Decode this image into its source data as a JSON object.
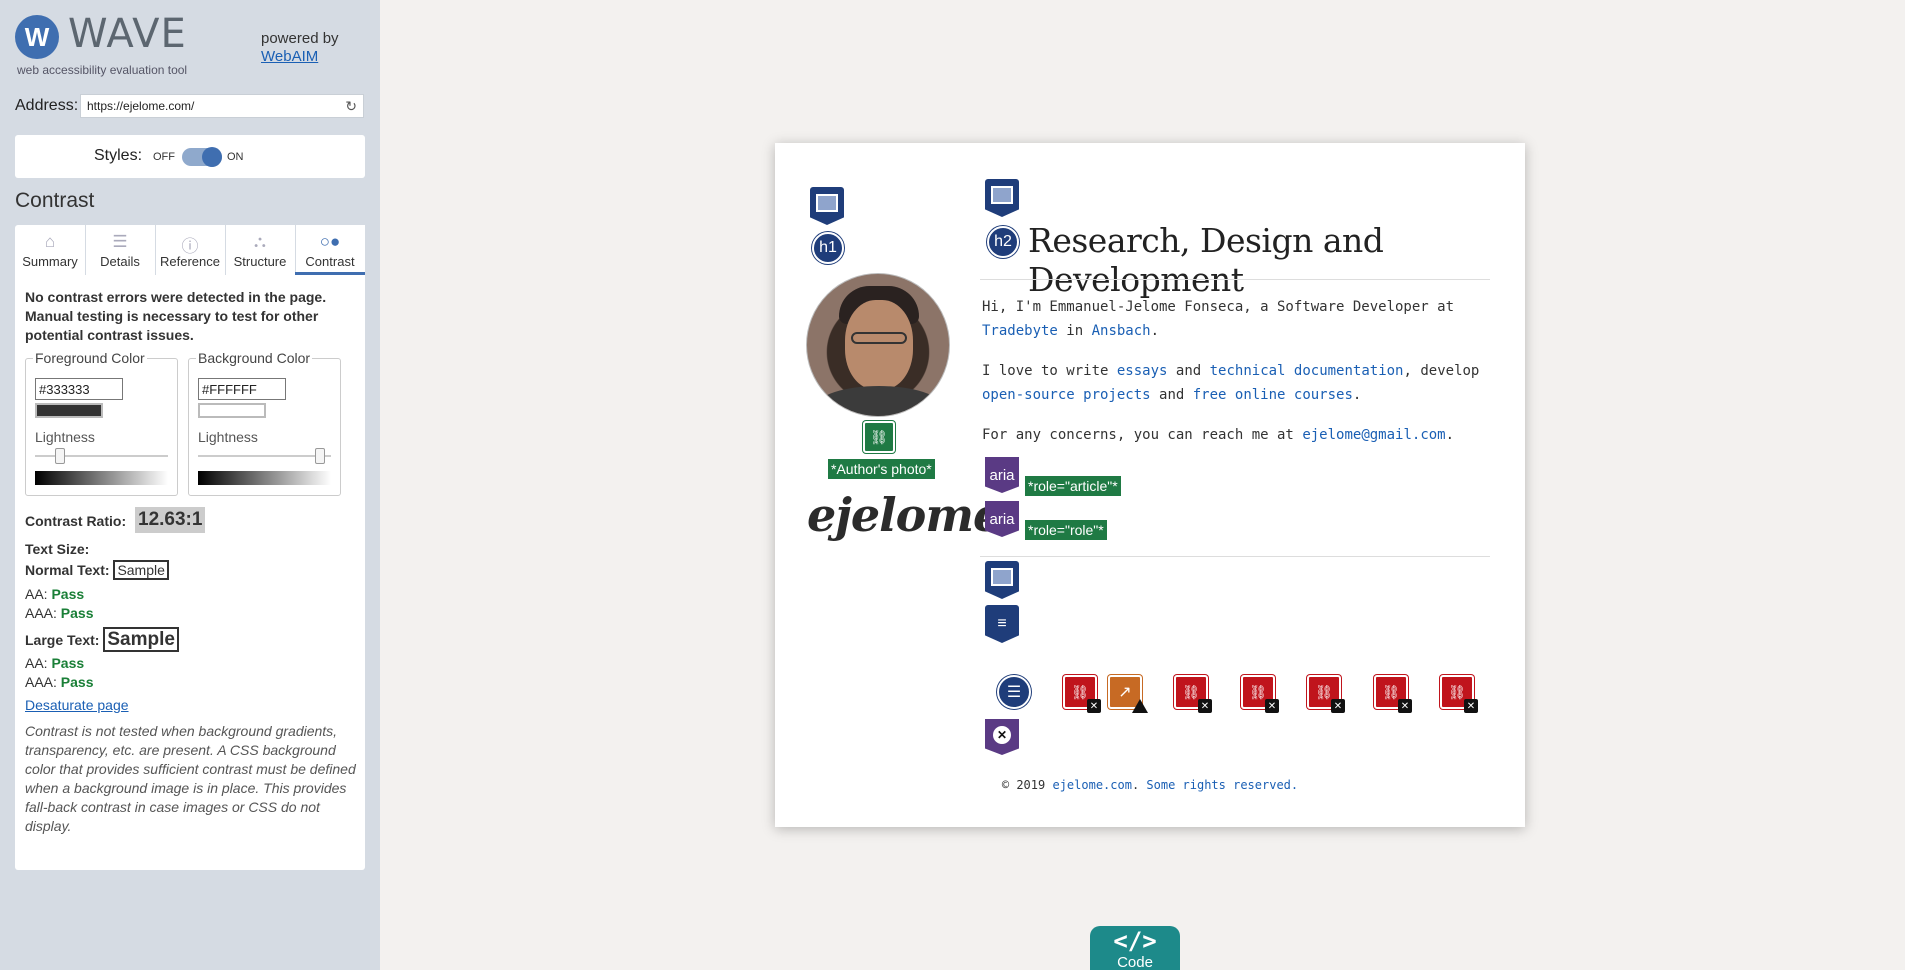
{
  "sidebar": {
    "logo_letter": "W",
    "logo_name": "WAVE",
    "tagline": "web accessibility evaluation tool",
    "powered_by": "powered by",
    "powered_link": "WebAIM",
    "address_label": "Address:",
    "address_value": "https://ejelome.com/",
    "styles_label": "Styles:",
    "styles_off": "OFF",
    "styles_on": "ON",
    "styles_state": "on",
    "section_title": "Contrast",
    "tabs": [
      {
        "label": "Summary",
        "icon": "home-icon"
      },
      {
        "label": "Details",
        "icon": "list-icon"
      },
      {
        "label": "Reference",
        "icon": "info-icon"
      },
      {
        "label": "Structure",
        "icon": "hierarchy-icon"
      },
      {
        "label": "Contrast",
        "icon": "contrast-icon",
        "active": true
      }
    ],
    "contrast": {
      "notice": "No contrast errors were detected in the page. Manual testing is necessary to test for other potential contrast issues.",
      "foreground_legend": "Foreground Color",
      "foreground_hex": "#333333",
      "foreground_color": "#333333",
      "background_legend": "Background Color",
      "background_hex": "#FFFFFF",
      "background_color": "#FFFFFF",
      "lightness_label": "Lightness",
      "ratio_label": "Contrast Ratio:",
      "ratio_value": "12.63:1",
      "text_size_label": "Text Size:",
      "normal_text_label": "Normal Text:",
      "large_text_label": "Large Text:",
      "sample": "Sample",
      "aa_label": "AA:",
      "aaa_label": "AAA:",
      "pass": "Pass",
      "desaturate_link": "Desaturate page",
      "note": "Contrast is not tested when background gradients, transparency, etc. are present. A CSS background color that provides sufficient contrast must be defined when a background image is in place. This provides fall-back contrast in case images or CSS do not display."
    }
  },
  "page": {
    "h1_badge": "h1",
    "h2_badge": "h2",
    "alt_text_label": "*Author's photo*",
    "signature": "ejelome",
    "heading": "Research, Design and Development",
    "intro_prefix": "Hi, I'm Emmanuel-Jelome Fonseca, a Software Developer at",
    "link_tradebyte": "Tradebyte",
    "intro_in": "in",
    "link_ansbach": "Ansbach",
    "love_prefix": "I love to write",
    "link_essays": "essays",
    "love_and": "and",
    "link_tech_docs": "technical documentation",
    "love_develop": ", develop",
    "link_oss": "open-source projects",
    "love_and2": "and",
    "link_courses": "free online courses",
    "concerns_prefix": "For any concerns, you can reach me at",
    "link_email": "ejelome@gmail.com",
    "aria_badge": "aria",
    "role_article": "*role=\"article\"*",
    "role_role": "*role=\"role\"*",
    "footer_prefix": "© 2019",
    "footer_link": "ejelome.com",
    "footer_rights": "Some rights reserved."
  },
  "code_button": {
    "label": "Code",
    "icon": "</>"
  },
  "colors": {
    "accent": "#3f6eb0",
    "pass": "#1a7f37",
    "sidebar_bg": "#d5dbe3",
    "code_teal": "#1d8a8a"
  }
}
